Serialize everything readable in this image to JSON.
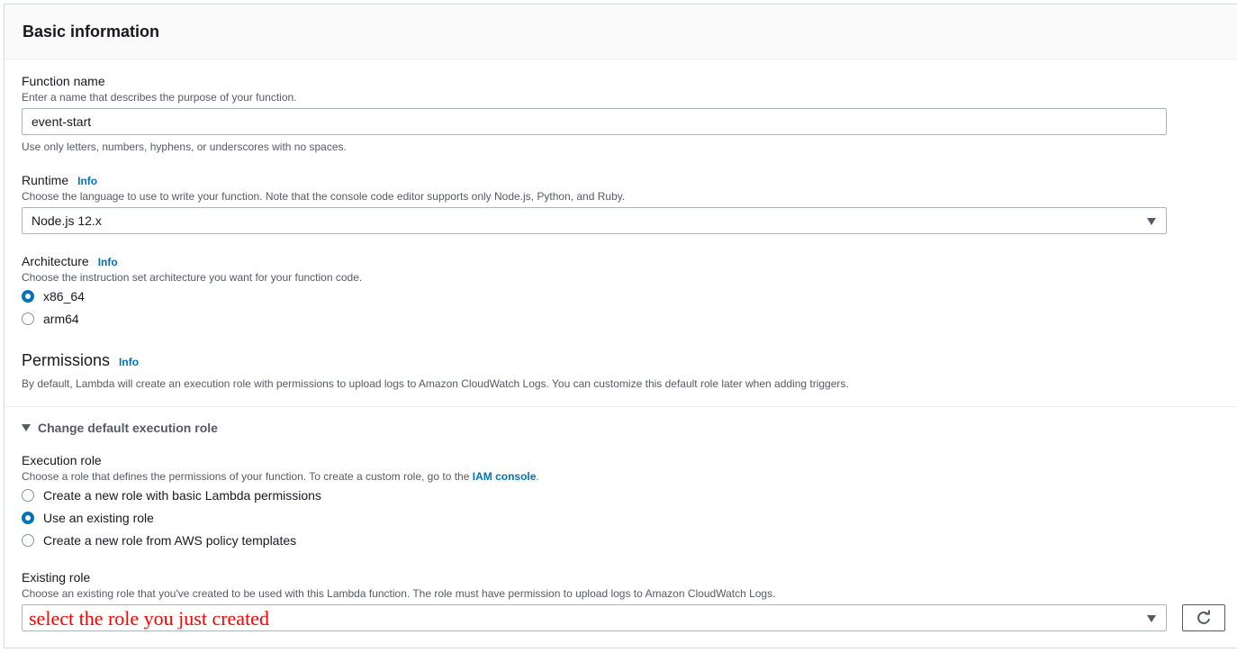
{
  "section": {
    "title": "Basic information"
  },
  "function_name": {
    "label": "Function name",
    "description": "Enter a name that describes the purpose of your function.",
    "value": "event-start",
    "hint": "Use only letters, numbers, hyphens, or underscores with no spaces."
  },
  "runtime": {
    "label": "Runtime",
    "info": "Info",
    "description": "Choose the language to use to write your function. Note that the console code editor supports only Node.js, Python, and Ruby.",
    "selected": "Node.js 12.x"
  },
  "architecture": {
    "label": "Architecture",
    "info": "Info",
    "description": "Choose the instruction set architecture you want for your function code.",
    "options": [
      {
        "label": "x86_64",
        "selected": true
      },
      {
        "label": "arm64",
        "selected": false
      }
    ]
  },
  "permissions": {
    "title": "Permissions",
    "info": "Info",
    "description": "By default, Lambda will create an execution role with permissions to upload logs to Amazon CloudWatch Logs. You can customize this default role later when adding triggers."
  },
  "execution_role_toggle": {
    "label": "Change default execution role",
    "expanded": true
  },
  "execution_role": {
    "label": "Execution role",
    "description_prefix": "Choose a role that defines the permissions of your function. To create a custom role, go to the",
    "link": "IAM console",
    "description_suffix": ".",
    "options": [
      {
        "label": "Create a new role with basic Lambda permissions",
        "selected": false
      },
      {
        "label": "Use an existing role",
        "selected": true
      },
      {
        "label": "Create a new role from AWS policy templates",
        "selected": false
      }
    ]
  },
  "existing_role": {
    "label": "Existing role",
    "description": "Choose an existing role that you've created to be used with this Lambda function. The role must have permission to upload logs to Amazon CloudWatch Logs.",
    "annotation": "select the role you just created",
    "refresh_icon": "refresh-icon"
  },
  "colors": {
    "accent": "#0073bb",
    "annotation": "#ff0000"
  }
}
